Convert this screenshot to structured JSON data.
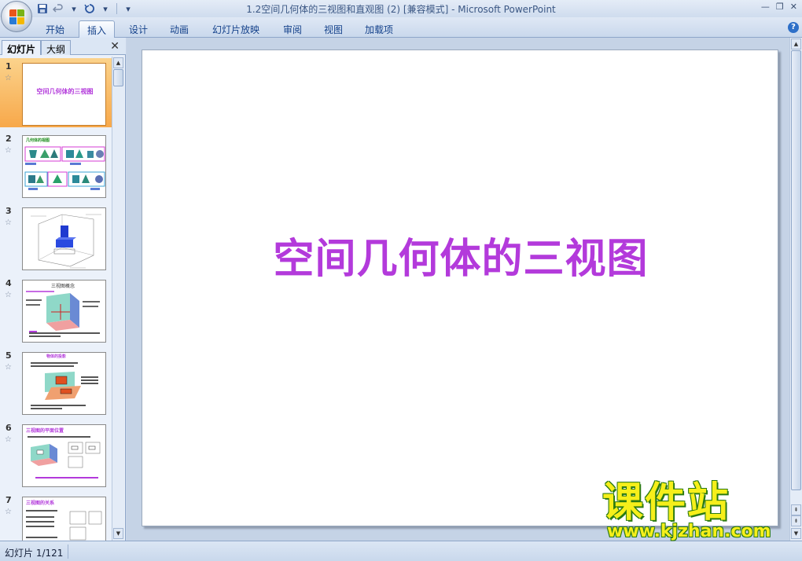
{
  "window": {
    "title": "1.2空间几何体的三视图和直观图 (2) [兼容模式] - Microsoft PowerPoint"
  },
  "ribbon": {
    "tabs": [
      {
        "label": "开始"
      },
      {
        "label": "插入"
      },
      {
        "label": "设计"
      },
      {
        "label": "动画"
      },
      {
        "label": "幻灯片放映"
      },
      {
        "label": "审阅"
      },
      {
        "label": "视图"
      },
      {
        "label": "加载项"
      }
    ],
    "active_tab": "插入"
  },
  "left_panel": {
    "tabs": [
      {
        "label": "幻灯片"
      },
      {
        "label": "大纲"
      }
    ],
    "thumbnails": [
      {
        "number": "1",
        "title": "空间几何体的三视图"
      },
      {
        "number": "2",
        "title": "几何体的视图"
      },
      {
        "number": "3"
      },
      {
        "number": "4",
        "title": "三视图概念"
      },
      {
        "number": "5",
        "title": "物体的投影"
      },
      {
        "number": "6",
        "title": "三视图的平面位置"
      },
      {
        "number": "7",
        "title": "三视图的关系"
      }
    ]
  },
  "slide": {
    "title": "空间几何体的三视图"
  },
  "status_bar": {
    "slide_info": "幻灯片 1/121"
  },
  "watermark": {
    "text": "课件站",
    "url": "www.kjzhan.com"
  },
  "colors": {
    "title_purple": "#b33adb",
    "selection_orange": "#f7a84a",
    "ribbon_blue": "#c9d8ec"
  }
}
